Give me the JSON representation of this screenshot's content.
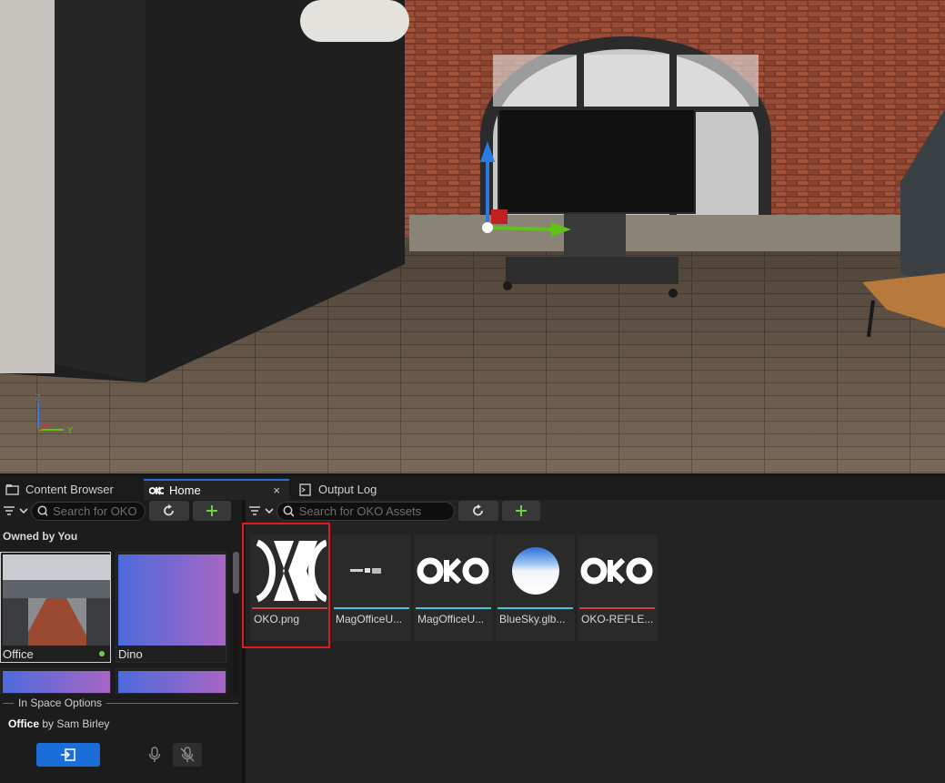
{
  "tabs": [
    {
      "label": "Content Browser",
      "icon": "folder-icon"
    },
    {
      "label": "Home",
      "icon": "oko-logo-icon",
      "close": "×"
    },
    {
      "label": "Output Log",
      "icon": "output-log-icon"
    }
  ],
  "left": {
    "search_placeholder": "Search for OKO",
    "section_title": "Owned by You",
    "spaces": [
      {
        "name": "Office",
        "online": true
      },
      {
        "name": "Dino",
        "online": false
      },
      {
        "name": "",
        "online": false
      },
      {
        "name": "",
        "online": false
      }
    ],
    "in_space_label": "In Space Options",
    "current_space": "Office",
    "by_text": "by Sam Birley"
  },
  "right": {
    "search_placeholder": "Search for OKO Assets",
    "assets": [
      {
        "name": "OKO.png",
        "bar_color": "#c94040"
      },
      {
        "name": "MagOfficeU...",
        "bar_color": "#38c8e0"
      },
      {
        "name": "MagOfficeU...",
        "bar_color": "#38c8e0"
      },
      {
        "name": "BlueSky.glb...",
        "bar_color": "#38c8e0"
      },
      {
        "name": "OKO-REFLE...",
        "bar_color": "#c94040"
      }
    ]
  },
  "viewport": {
    "axis_z": "Z",
    "axis_y": "Y"
  },
  "colors": {
    "accent": "#1b6ed8",
    "highlight": "#e01b1b",
    "add_green": "#6fd23c"
  }
}
